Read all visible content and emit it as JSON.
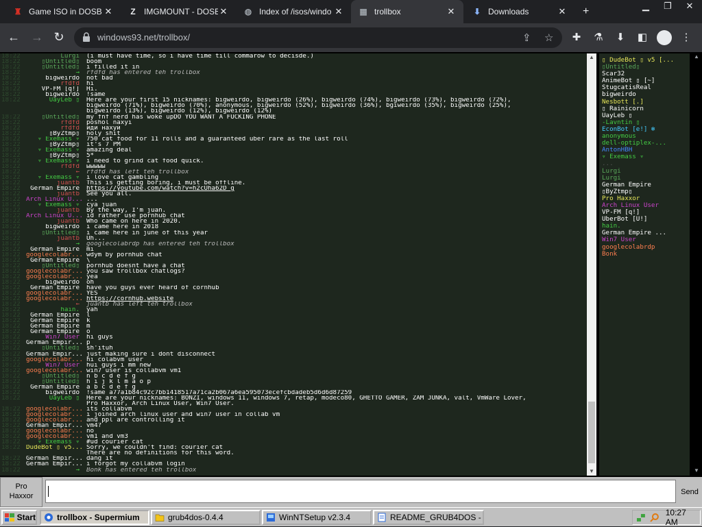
{
  "browser": {
    "tabs": [
      {
        "label": "Game ISO in DOSB",
        "icon": "red-joystick-icon",
        "color": "#d93025",
        "active": false
      },
      {
        "label": "IMGMOUNT - DOSB",
        "icon": "z-letter-icon",
        "color": "#e8eaed",
        "active": false
      },
      {
        "label": "Index of /isos/windo",
        "icon": "globe-icon",
        "color": "#9aa0a6",
        "active": false
      },
      {
        "label": "trollbox",
        "icon": "trollbox-icon",
        "color": "#9aa0a6",
        "active": true
      },
      {
        "label": "Downloads",
        "icon": "download-icon",
        "color": "#8ab4f8",
        "active": false
      }
    ],
    "url": "windows93.net/trollbox/"
  },
  "chat": {
    "messages": [
      {
        "time": "18:22",
        "nick": "Lurgi",
        "nick_color": "#5aa85a",
        "text": "(i must have time, so i have time till commarow to decisde.)",
        "kind": "normal"
      },
      {
        "time": "18:22",
        "nick": "▯Untitled▯",
        "nick_color": "#5aa85a",
        "text": "boom",
        "kind": "normal"
      },
      {
        "time": "18:22",
        "nick": "▯Untitled▯",
        "nick_color": "#5aa85a",
        "text": "i filled it in",
        "kind": "normal"
      },
      {
        "time": "18:22",
        "nick": "→",
        "nick_color": "#44cc44",
        "text": "rfdfd has entered teh trollbox",
        "kind": "system"
      },
      {
        "time": "18:22",
        "nick": "bigweirdo",
        "nick_color": "#ffffff",
        "text": "not bad",
        "kind": "normal"
      },
      {
        "time": "18:22",
        "nick": "rfdfd",
        "nick_color": "#d04f4f",
        "text": "hi",
        "kind": "normal"
      },
      {
        "time": "18:22",
        "nick": "VP-FM [q!]",
        "nick_color": "#ffffff",
        "text": "Hi.",
        "kind": "normal"
      },
      {
        "time": "18:22",
        "nick": "bigweirdo",
        "nick_color": "#ffffff",
        "text": "!same",
        "kind": "normal"
      },
      {
        "time": "18:22",
        "nick": "UayLeb ▯",
        "nick_color": "#44cc44",
        "text": "Here are your first 15 nicknames: bigweirdo, bigweirdo (26%), bigweirdo (74%), bigweirdo (73%), bigweirdo (72%),",
        "kind": "normal"
      },
      {
        "time": "",
        "nick": "",
        "nick_color": "#ffffff",
        "text": "bigweirdo (71%), bigweirdo (70%), anonymous, bigweirdo (52%), bigweirdo (36%), bgiweirdo (35%), bigweirdo (25%),",
        "kind": "normal"
      },
      {
        "time": "",
        "nick": "",
        "nick_color": "#ffffff",
        "text": "bigweirdo (13%), bigweirdo (12%), bigweirdo (12%)",
        "kind": "normal"
      },
      {
        "time": "18:22",
        "nick": "▯Untitled▯",
        "nick_color": "#5aa85a",
        "text": "my fnf nerd has woke upDO YOU WANT A FUCKING PHONE",
        "kind": "normal"
      },
      {
        "time": "18:22",
        "nick": "rfdfd",
        "nick_color": "#d04f4f",
        "text": "poshol naxyi",
        "kind": "normal"
      },
      {
        "time": "18:22",
        "nick": "rfdfd",
        "nick_color": "#d04f4f",
        "text": "иди нахуй",
        "kind": "normal"
      },
      {
        "time": "18:22",
        "nick": "▯ByZtmp▯",
        "nick_color": "#ffffff",
        "text": "holy shit",
        "kind": "normal"
      },
      {
        "time": "18:22",
        "nick": "▿ Exemass ▿",
        "nick_color": "#44cc44",
        "text": "750 cat food for 11 rolls and a guaranteed uber rare as the last roll",
        "kind": "normal"
      },
      {
        "time": "18:22",
        "nick": "▯ByZtmp▯",
        "nick_color": "#ffffff",
        "text": "it's 7 PM",
        "kind": "normal"
      },
      {
        "time": "18:22",
        "nick": "▿ Exemass ▿",
        "nick_color": "#44cc44",
        "text": "amazing deal",
        "kind": "normal"
      },
      {
        "time": "18:22",
        "nick": "▯ByZtmp▯",
        "nick_color": "#ffffff",
        "text": "5*",
        "kind": "normal"
      },
      {
        "time": "18:22",
        "nick": "▿ Exemass ▿",
        "nick_color": "#44cc44",
        "text": "i need to grind cat food quick.",
        "kind": "normal"
      },
      {
        "time": "18:22",
        "nick": "rfdfd",
        "nick_color": "#d04f4f",
        "text": "ыыыыы",
        "kind": "normal"
      },
      {
        "time": "18:22",
        "nick": "←",
        "nick_color": "#d04f4f",
        "text": "rfdfd has left teh trollbox",
        "kind": "system"
      },
      {
        "time": "18:22",
        "nick": "▿ Exemass ▿",
        "nick_color": "#44cc44",
        "text": "i love cat gambling",
        "kind": "normal"
      },
      {
        "time": "18:22",
        "nick": "juantb",
        "nick_color": "#d04f4f",
        "text": "This is getting boring, i must be offline.",
        "kind": "normal"
      },
      {
        "time": "18:22",
        "nick": "German Empire",
        "nick_color": "#ffffff",
        "text": "https://youtube.com/watch?v=h2cUha62D_g",
        "kind": "link"
      },
      {
        "time": "18:22",
        "nick": "juantb",
        "nick_color": "#d04f4f",
        "text": "See you all.",
        "kind": "normal"
      },
      {
        "time": "18:22",
        "nick": "Arch Linux U...",
        "nick_color": "#cc44cc",
        "text": "...",
        "kind": "normal"
      },
      {
        "time": "18:22",
        "nick": "▿ Exemass ▿",
        "nick_color": "#44cc44",
        "text": "cya juan",
        "kind": "normal"
      },
      {
        "time": "18:22",
        "nick": "juantb",
        "nick_color": "#d04f4f",
        "text": "By the way, I'm juan.",
        "kind": "normal"
      },
      {
        "time": "18:22",
        "nick": "Arch Linux U...",
        "nick_color": "#cc44cc",
        "text": "id rather use pornhub chat",
        "kind": "normal"
      },
      {
        "time": "18:22",
        "nick": "juantb",
        "nick_color": "#d04f4f",
        "text": "Who came on here in 2020.",
        "kind": "normal"
      },
      {
        "time": "18:22",
        "nick": "bigweirdo",
        "nick_color": "#ffffff",
        "text": "i came here in 2018",
        "kind": "normal"
      },
      {
        "time": "18:22",
        "nick": "▯Untitled▯",
        "nick_color": "#5aa85a",
        "text": "i came here in june of this year",
        "kind": "normal"
      },
      {
        "time": "18:22",
        "nick": "juantb",
        "nick_color": "#d04f4f",
        "text": "Uh...",
        "kind": "normal"
      },
      {
        "time": "18:22",
        "nick": "→",
        "nick_color": "#44cc44",
        "text": "googlecolabrdp has entered teh trollbox",
        "kind": "system"
      },
      {
        "time": "18:22",
        "nick": "German Empire",
        "nick_color": "#ffffff",
        "text": "mi",
        "kind": "normal"
      },
      {
        "time": "18:22",
        "nick": "googlecolabr...",
        "nick_color": "#ff7f50",
        "text": "wdym by pornhub chat",
        "kind": "normal"
      },
      {
        "time": "18:22",
        "nick": "German Empire",
        "nick_color": "#ffffff",
        "text": "\\",
        "kind": "normal"
      },
      {
        "time": "18:22",
        "nick": "▯Untitled▯",
        "nick_color": "#5aa85a",
        "text": "pornhub doesnt have a chat",
        "kind": "normal"
      },
      {
        "time": "18:22",
        "nick": "googlecolabr...",
        "nick_color": "#ff7f50",
        "text": "you saw trollbox chatlogs?",
        "kind": "normal"
      },
      {
        "time": "18:22",
        "nick": "googlecolabr...",
        "nick_color": "#ff7f50",
        "text": "yea",
        "kind": "normal"
      },
      {
        "time": "18:22",
        "nick": "bigweirdo",
        "nick_color": "#ffffff",
        "text": "oh",
        "kind": "normal"
      },
      {
        "time": "18:22",
        "nick": "German Empire",
        "nick_color": "#ffffff",
        "text": "have you guys ever heard of cornhub",
        "kind": "normal"
      },
      {
        "time": "18:22",
        "nick": "googlecolabr...",
        "nick_color": "#ff7f50",
        "text": "YES",
        "kind": "normal"
      },
      {
        "time": "18:22",
        "nick": "googlecolabr...",
        "nick_color": "#ff7f50",
        "text": "https://cornhub.website",
        "kind": "link"
      },
      {
        "time": "18:22",
        "nick": "←",
        "nick_color": "#d04f4f",
        "text": "juantb has left teh trollbox",
        "kind": "system"
      },
      {
        "time": "18:22",
        "nick": "hain.",
        "nick_color": "#44cc44",
        "text": "yah",
        "kind": "normal"
      },
      {
        "time": "18:22",
        "nick": "German Empire",
        "nick_color": "#ffffff",
        "text": "l",
        "kind": "normal"
      },
      {
        "time": "18:22",
        "nick": "German Empire",
        "nick_color": "#ffffff",
        "text": "k",
        "kind": "normal"
      },
      {
        "time": "18:22",
        "nick": "German Empire",
        "nick_color": "#ffffff",
        "text": "m",
        "kind": "normal"
      },
      {
        "time": "18:22",
        "nick": "German Empire",
        "nick_color": "#ffffff",
        "text": "o",
        "kind": "normal"
      },
      {
        "time": "18:22",
        "nick": "Win7 User",
        "nick_color": "#cc44cc",
        "text": "hi guys",
        "kind": "normal"
      },
      {
        "time": "18:22",
        "nick": "German Empir...",
        "nick_color": "#ffffff",
        "text": "p",
        "kind": "normal"
      },
      {
        "time": "18:22",
        "nick": "▯Untitled▯",
        "nick_color": "#5aa85a",
        "text": "sh'ituh",
        "kind": "normal"
      },
      {
        "time": "18:22",
        "nick": "German Empir...",
        "nick_color": "#ffffff",
        "text": "just making sure i dont disconnect",
        "kind": "normal"
      },
      {
        "time": "18:22",
        "nick": "googlecolabr...",
        "nick_color": "#ff7f50",
        "text": "hi colabvm user",
        "kind": "normal"
      },
      {
        "time": "18:22",
        "nick": "Win7 User",
        "nick_color": "#cc44cc",
        "text": "hui guys i mm new",
        "kind": "normal"
      },
      {
        "time": "18:22",
        "nick": "googlecolabr...",
        "nick_color": "#ff7f50",
        "text": "win7 user is collabvm vm1",
        "kind": "normal"
      },
      {
        "time": "18:22",
        "nick": "▯Untitled▯",
        "nick_color": "#5aa85a",
        "text": "n b c d e f g",
        "kind": "normal"
      },
      {
        "time": "18:22",
        "nick": "▯Untitled▯",
        "nick_color": "#5aa85a",
        "text": "h i j k l m a o p",
        "kind": "normal"
      },
      {
        "time": "18:22",
        "nick": "German Empire",
        "nick_color": "#ffffff",
        "text": "a b c d e f g",
        "kind": "normal"
      },
      {
        "time": "18:22",
        "nick": "bigweirdo",
        "nick_color": "#ffffff",
        "text": "!same a77a1b84c92c7bb1418517a71ca2b067a6ea595073ecefcbdadeb5d6d6d87259",
        "kind": "normal"
      },
      {
        "time": "18:22",
        "nick": "UayLeb ▯",
        "nick_color": "#44cc44",
        "text": "Here are your nicknames: BONZI, windows 11, windows 7, retap, modeco80, GHETTO GAMER, ZAM JUNKA, valt, VmWare Lover,",
        "kind": "normal"
      },
      {
        "time": "",
        "nick": "",
        "nick_color": "#ffffff",
        "text": "Pro Haxxor, Arch Linux User, Win7 User.",
        "kind": "normal"
      },
      {
        "time": "18:22",
        "nick": "googlecolabr...",
        "nick_color": "#ff7f50",
        "text": "its collabvm",
        "kind": "normal"
      },
      {
        "time": "18:22",
        "nick": "googlecolabr...",
        "nick_color": "#ff7f50",
        "text": "i joined arch linux user and win7 user in collab vm",
        "kind": "normal"
      },
      {
        "time": "18:22",
        "nick": "googlecolabr...",
        "nick_color": "#ff7f50",
        "text": "and ppl are controlling it",
        "kind": "normal"
      },
      {
        "time": "18:22",
        "nick": "German Empir...",
        "nick_color": "#ffffff",
        "text": "vm4?",
        "kind": "normal"
      },
      {
        "time": "18:22",
        "nick": "googlecolabr...",
        "nick_color": "#ff7f50",
        "text": "no",
        "kind": "normal"
      },
      {
        "time": "18:22",
        "nick": "googlecolabr...",
        "nick_color": "#ff7f50",
        "text": "vm1 and vm3",
        "kind": "normal"
      },
      {
        "time": "18:22",
        "nick": "▿ Exemass ▿",
        "nick_color": "#44cc44",
        "text": "#ud courier cat",
        "kind": "normal"
      },
      {
        "time": "18:22",
        "nick": "DudeBot ▯ v5...",
        "nick_color": "#e8e85a",
        "text": "Sorry, we couldn't find: courier cat",
        "kind": "normal"
      },
      {
        "time": "",
        "nick": "",
        "nick_color": "#ffffff",
        "text": "There are no definitions for this word.",
        "kind": "normal"
      },
      {
        "time": "18:22",
        "nick": "German Empir...",
        "nick_color": "#ffffff",
        "text": "dang it",
        "kind": "normal"
      },
      {
        "time": "18:22",
        "nick": "German Empir...",
        "nick_color": "#ffffff",
        "text": "i forgot my collabvm login",
        "kind": "normal"
      },
      {
        "time": "18:22",
        "nick": "→",
        "nick_color": "#44cc44",
        "text": "Bonk has entered teh trollbox",
        "kind": "system"
      }
    ]
  },
  "users": [
    {
      "name": "▯ DudeBot ▯ v5 [...",
      "color": "#e8e85a"
    },
    {
      "name": "▯Untitled▯",
      "color": "#5aa85a"
    },
    {
      "name": "Scar32",
      "color": "#ffffff"
    },
    {
      "name": "AnimeBot ▯ [~]",
      "color": "#ffffff"
    },
    {
      "name": "StugcatisReal",
      "color": "#ffffff"
    },
    {
      "name": "bigweirdo",
      "color": "#ffffff"
    },
    {
      "name": "Nesbott [.]",
      "color": "#e8e85a"
    },
    {
      "name": "▯ Rainicorn",
      "color": "#ffffff"
    },
    {
      "name": "UayLeb ▯",
      "color": "#ffffff"
    },
    {
      "name": "-Lavntin ▯",
      "color": "#44cc44"
    },
    {
      "name": "EconBot [e!] ❄",
      "color": "#44ccff"
    },
    {
      "name": "anonymous",
      "color": "#44cc44"
    },
    {
      "name": "dell-optiplex-...",
      "color": "#44cc44"
    },
    {
      "name": "AntonHBH",
      "color": "#4488ff"
    },
    {
      "name": "▿ Exemass ▿",
      "color": "#44cc44"
    },
    {
      "name": "...",
      "color": "#555555"
    },
    {
      "name": "Lurgi",
      "color": "#5aa85a"
    },
    {
      "name": "Lurgi",
      "color": "#5aa85a"
    },
    {
      "name": "German Empire",
      "color": "#ffffff"
    },
    {
      "name": "▯ByZtmp▯",
      "color": "#ffffff"
    },
    {
      "name": "Pro Haxxor",
      "color": "#e8e85a"
    },
    {
      "name": "Arch Linux User",
      "color": "#cc44cc"
    },
    {
      "name": "VP-FM [q!]",
      "color": "#ffffff"
    },
    {
      "name": "UberBot [U!]",
      "color": "#ffffff"
    },
    {
      "name": "hain.",
      "color": "#44cc44"
    },
    {
      "name": "German Empire ...",
      "color": "#ffffff"
    },
    {
      "name": "Win7 User",
      "color": "#cc44cc"
    },
    {
      "name": "googlecolabrdp",
      "color": "#ff7f50"
    },
    {
      "name": "Bonk",
      "color": "#ff7f50"
    }
  ],
  "bottom": {
    "nick_line1": "Pro",
    "nick_line2": "Haxxor",
    "input_value": "",
    "send_label": "Send"
  },
  "taskbar": {
    "start_label": "Start",
    "items": [
      {
        "label": "trollbox - Supermium",
        "icon": "browser-icon",
        "active": true
      },
      {
        "label": "grub4dos-0.4.4",
        "icon": "folder-icon",
        "active": false
      },
      {
        "label": "WinNTSetup v2.3.4",
        "icon": "setup-icon",
        "active": false
      },
      {
        "label": "README_GRUB4DOS - ...",
        "icon": "notepad-icon",
        "active": false
      }
    ],
    "clock": "10:27 AM"
  }
}
